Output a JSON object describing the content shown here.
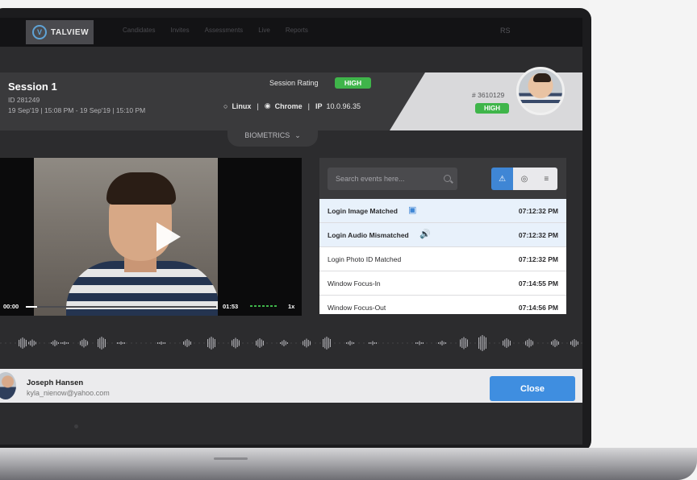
{
  "nav": {
    "logo_text": "TALVIEW",
    "links": [
      "Candidates",
      "Invites",
      "Assessments",
      "Live",
      "Reports"
    ],
    "user_initials": "RS"
  },
  "session": {
    "title": "Session 1",
    "id": "ID 281249",
    "time_range": "19 Sep'19 | 15:08 PM - 19 Sep'19 | 15:10 PM",
    "rating_label": "Session Rating",
    "rating_value": "HIGH",
    "os": "Linux",
    "browser": "Chrome",
    "ip_label": "IP",
    "ip": "10.0.96.35"
  },
  "candidate": {
    "number": "# 3610129",
    "rating": "HIGH",
    "name": "Joseph Hansen",
    "email": "kyla_nienow@yahoo.com"
  },
  "biometrics_tab": "BIOMETRICS",
  "video": {
    "current_time": "00:00",
    "duration": "01:53",
    "speed": "1x",
    "progress": 0.06
  },
  "events": {
    "search_placeholder": "Search events here...",
    "filter_icons": [
      "warning-icon",
      "globe-icon",
      "sliders-icon"
    ],
    "rows": [
      {
        "name": "Login Image Matched",
        "time": "07:12:32 PM"
      },
      {
        "name": "Login Audio Mismatched",
        "time": "07:12:32 PM"
      },
      {
        "name": "Login Photo ID Matched",
        "time": "07:12:32 PM"
      },
      {
        "name": "Window Focus-In",
        "time": "07:14:55 PM"
      },
      {
        "name": "Window Focus-Out",
        "time": "07:14:56 PM"
      }
    ]
  },
  "footer": {
    "close_label": "Close"
  },
  "colors": {
    "accent_blue": "#3f8ee0",
    "badge_green": "#3fb54a",
    "header_dark": "#3a3a3c"
  }
}
